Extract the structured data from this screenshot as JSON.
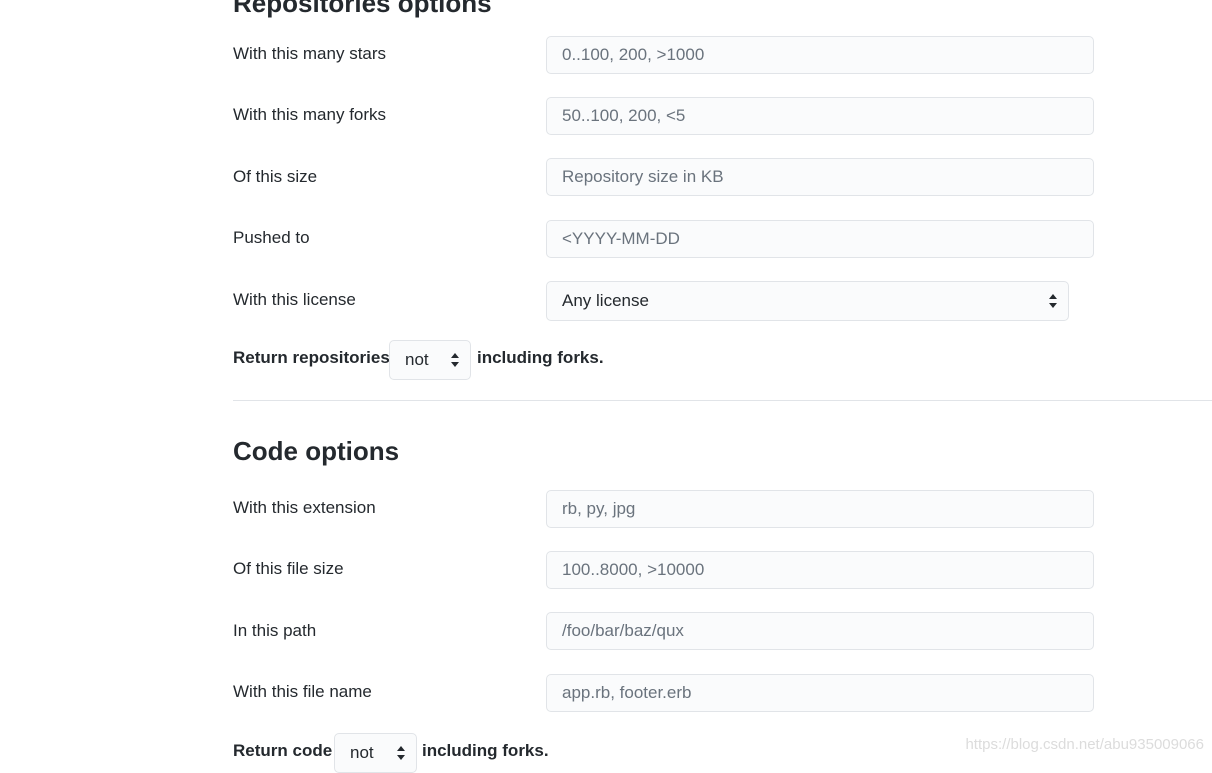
{
  "repositories": {
    "title": "Repositories options",
    "stars": {
      "label": "With this many stars",
      "placeholder": "0..100, 200, >1000"
    },
    "forks": {
      "label": "With this many forks",
      "placeholder": "50..100, 200, <5"
    },
    "size": {
      "label": "Of this size",
      "placeholder": "Repository size in KB"
    },
    "pushed": {
      "label": "Pushed to",
      "placeholder": "<YYYY-MM-DD"
    },
    "license": {
      "label": "With this license",
      "selected": "Any license"
    },
    "return_row": {
      "prefix": "Return repositories",
      "selected": "not",
      "suffix": "including forks."
    }
  },
  "code": {
    "title": "Code options",
    "extension": {
      "label": "With this extension",
      "placeholder": "rb, py, jpg"
    },
    "file_size": {
      "label": "Of this file size",
      "placeholder": "100..8000, >10000"
    },
    "path": {
      "label": "In this path",
      "placeholder": "/foo/bar/baz/qux"
    },
    "file_name": {
      "label": "With this file name",
      "placeholder": "app.rb, footer.erb"
    },
    "return_row": {
      "prefix": "Return code",
      "selected": "not",
      "suffix": "including forks."
    }
  },
  "watermark": "https://blog.csdn.net/abu935009066",
  "icons": {
    "select_arrow": "up-down-caret-icon"
  },
  "colors": {
    "text": "#24292e",
    "placeholder": "#6a737d",
    "border": "#e1e4e8",
    "field_bg": "#fafbfc"
  }
}
